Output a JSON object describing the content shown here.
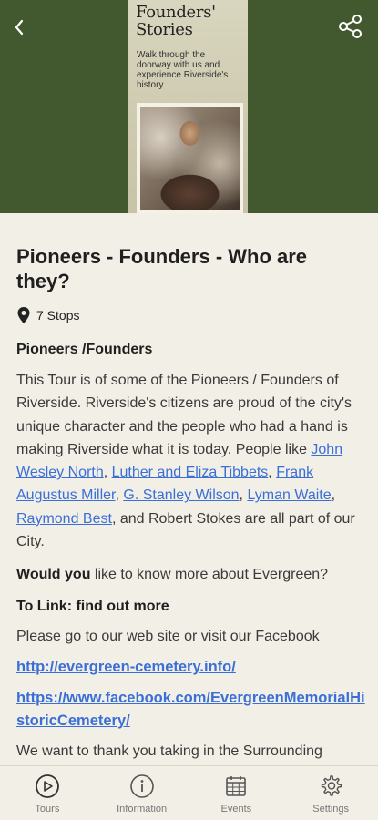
{
  "cover": {
    "title_line1": "Founders'",
    "title_line2": "Stories",
    "subtitle": "Walk through the doorway with us and experience Riverside's history"
  },
  "tour": {
    "title": "Pioneers - Founders - Who are they?",
    "stops": "7 Stops",
    "section_heading": "Pioneers /Founders"
  },
  "body": {
    "p1_start": "This Tour is of some of the Pioneers / Founders of Riverside. Riverside's citizens are proud of the city's unique character and the people who had a hand is making Riverside what it is today. People like ",
    "link_north": "John Wesley North",
    "sep1": ", ",
    "link_tibbets": "Luther and Eliza Tibbets",
    "sep2": ", ",
    "link_miller": "Frank Augustus Miller",
    "sep3": ", ",
    "link_wilson": "G. Stanley Wilson",
    "sep4": ", ",
    "link_waite": "Lyman Waite",
    "sep5": ", ",
    "link_best": "Raymond Best",
    "p1_end": ", and Robert Stokes are all part of our City.",
    "p2_bold": "Would you",
    "p2_rest": " like to know more about Evergreen?",
    "p3": "To Link: find out more",
    "p4": "Please go to our web site or visit our Facebook",
    "url_site": "http://evergreen-cemetery.info/",
    "url_facebook": "https://www.facebook.com/EvergreenMemorialHistoricCemetery/",
    "p7": "We want to thank you taking in the Surrounding"
  },
  "nav": {
    "tours": "Tours",
    "information": "Information",
    "events": "Events",
    "settings": "Settings"
  },
  "colors": {
    "header_bg": "#42582f",
    "page_bg": "#f2efe6",
    "link": "#3b6fd8"
  }
}
